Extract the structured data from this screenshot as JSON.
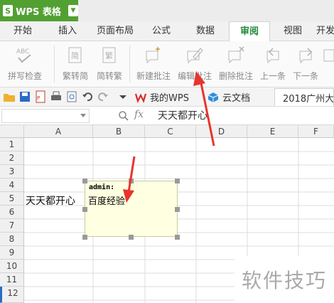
{
  "app": {
    "title": "WPS 表格",
    "logo": "S"
  },
  "tabs": [
    "开始",
    "插入",
    "页面布局",
    "公式",
    "数据",
    "审阅",
    "视图",
    "开发"
  ],
  "active_tab": "审阅",
  "ribbon": {
    "spellcheck": "拼写检查",
    "trad_to_simp": "繁转简",
    "simp_to_trad": "简转繁",
    "new_comment": "新建批注",
    "edit_comment": "编辑批注",
    "delete_comment": "删除批注",
    "prev": "上一条",
    "next": "下一条"
  },
  "doc_tabs": {
    "mywps": "我的WPS",
    "cloud": "云文档",
    "file": "2018广州大"
  },
  "formula_bar": {
    "fx": "fx",
    "content": "天天都开心"
  },
  "columns": [
    "A",
    "B",
    "C",
    "D",
    "E",
    "F"
  ],
  "rows": [
    "1",
    "2",
    "3",
    "4",
    "5",
    "6",
    "7",
    "8",
    "9",
    "10",
    "11",
    "12"
  ],
  "cells": {
    "A5": "天天都开心"
  },
  "comment": {
    "author": "admin:",
    "text": "百度经验"
  },
  "watermark": "软件技巧",
  "colors": {
    "brand_green": "#52a032",
    "active_tab_text": "#1f8c3b",
    "arrow_red": "#e8342c",
    "comment_bg": "#ffffe1"
  }
}
